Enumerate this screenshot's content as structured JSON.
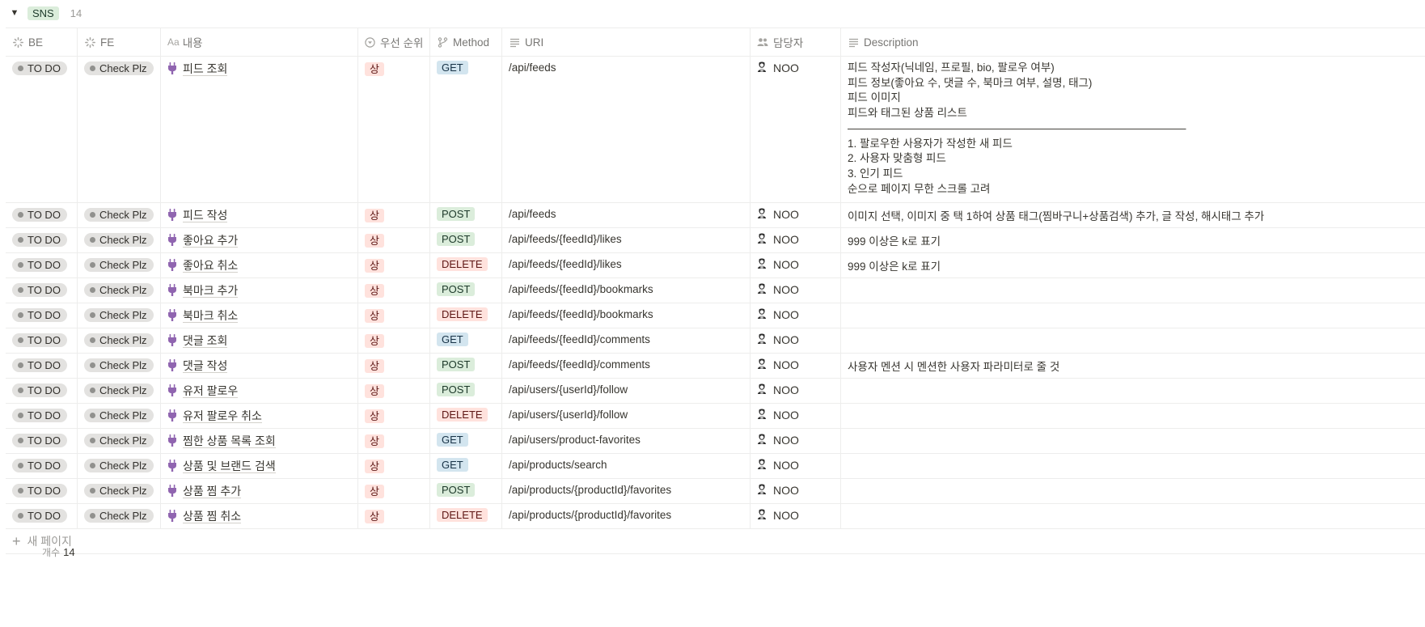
{
  "group": {
    "label": "SNS",
    "count": "14"
  },
  "columns": {
    "be": "BE",
    "fe": "FE",
    "name_prefix": "Aa",
    "name": "내용",
    "priority": "우선 순위",
    "method": "Method",
    "uri": "URI",
    "owner": "담당자",
    "description": "Description"
  },
  "rows": [
    {
      "be": "TO DO",
      "fe": "Check Plz",
      "name": "피드 조회",
      "priority": "상",
      "method": "GET",
      "uri": "/api/feeds",
      "owner": "NOO",
      "description": [
        "피드 작성자(닉네임, 프로필, bio, 팔로우 여부)",
        "피드 정보(좋아요 수, 댓글 수, 북마크 여부, 설명, 태그)",
        "피드 이미지",
        "피드와 태그된 상품 리스트",
        "———————————————————————————————",
        "1. 팔로우한 사용자가 작성한 새 피드",
        "2. 사용자 맞춤형 피드",
        "3. 인기 피드",
        "순으로 페이지 무한 스크롤 고려"
      ]
    },
    {
      "be": "TO DO",
      "fe": "Check Plz",
      "name": "피드 작성",
      "priority": "상",
      "method": "POST",
      "uri": "/api/feeds",
      "owner": "NOO",
      "description": "이미지 선택, 이미지 중 택 1하여 상품 태그(찜바구니+상품검색) 추가, 글 작성, 해시태그 추가"
    },
    {
      "be": "TO DO",
      "fe": "Check Plz",
      "name": "좋아요 추가",
      "priority": "상",
      "method": "POST",
      "uri": "/api/feeds/{feedId}/likes",
      "owner": "NOO",
      "description": "999 이상은 k로 표기"
    },
    {
      "be": "TO DO",
      "fe": "Check Plz",
      "name": "좋아요 취소",
      "priority": "상",
      "method": "DELETE",
      "uri": "/api/feeds/{feedId}/likes",
      "owner": "NOO",
      "description": "999 이상은 k로 표기"
    },
    {
      "be": "TO DO",
      "fe": "Check Plz",
      "name": "북마크 추가",
      "priority": "상",
      "method": "POST",
      "uri": "/api/feeds/{feedId}/bookmarks",
      "owner": "NOO",
      "description": ""
    },
    {
      "be": "TO DO",
      "fe": "Check Plz",
      "name": "북마크 취소",
      "priority": "상",
      "method": "DELETE",
      "uri": "/api/feeds/{feedId}/bookmarks",
      "owner": "NOO",
      "description": ""
    },
    {
      "be": "TO DO",
      "fe": "Check Plz",
      "name": "댓글 조회",
      "priority": "상",
      "method": "GET",
      "uri": "/api/feeds/{feedId}/comments",
      "owner": "NOO",
      "description": ""
    },
    {
      "be": "TO DO",
      "fe": "Check Plz",
      "name": "댓글 작성",
      "priority": "상",
      "method": "POST",
      "uri": "/api/feeds/{feedId}/comments",
      "owner": "NOO",
      "description": "사용자 멘션 시 멘션한 사용자 파라미터로 줄 것"
    },
    {
      "be": "TO DO",
      "fe": "Check Plz",
      "name": "유저 팔로우",
      "priority": "상",
      "method": "POST",
      "uri": "/api/users/{userId}/follow",
      "owner": "NOO",
      "description": ""
    },
    {
      "be": "TO DO",
      "fe": "Check Plz",
      "name": "유저 팔로우 취소",
      "priority": "상",
      "method": "DELETE",
      "uri": "/api/users/{userId}/follow",
      "owner": "NOO",
      "description": ""
    },
    {
      "be": "TO DO",
      "fe": "Check Plz",
      "name": "찜한 상품 목록 조회",
      "priority": "상",
      "method": "GET",
      "uri": "/api/users/product-favorites",
      "owner": "NOO",
      "description": ""
    },
    {
      "be": "TO DO",
      "fe": "Check Plz",
      "name": "상품 및 브랜드 검색",
      "priority": "상",
      "method": "GET",
      "uri": "/api/products/search",
      "owner": "NOO",
      "description": ""
    },
    {
      "be": "TO DO",
      "fe": "Check Plz",
      "name": "상품 찜 추가",
      "priority": "상",
      "method": "POST",
      "uri": "/api/products/{productId}/favorites",
      "owner": "NOO",
      "description": ""
    },
    {
      "be": "TO DO",
      "fe": "Check Plz",
      "name": "상품 찜 취소",
      "priority": "상",
      "method": "DELETE",
      "uri": "/api/products/{productId}/favorites",
      "owner": "NOO",
      "description": ""
    }
  ],
  "new_page": "새 페이지",
  "footer": {
    "label": "개수",
    "count": "14"
  },
  "icons": {
    "row_icon": "plug-icon",
    "owner_icon": "person-icon"
  },
  "colors": {
    "priority_bg": "#ffe2dd",
    "get_bg": "#d3e5ef",
    "post_bg": "#dbeddb",
    "delete_bg": "#ffe2dd",
    "status_bg": "#e3e2e0"
  }
}
